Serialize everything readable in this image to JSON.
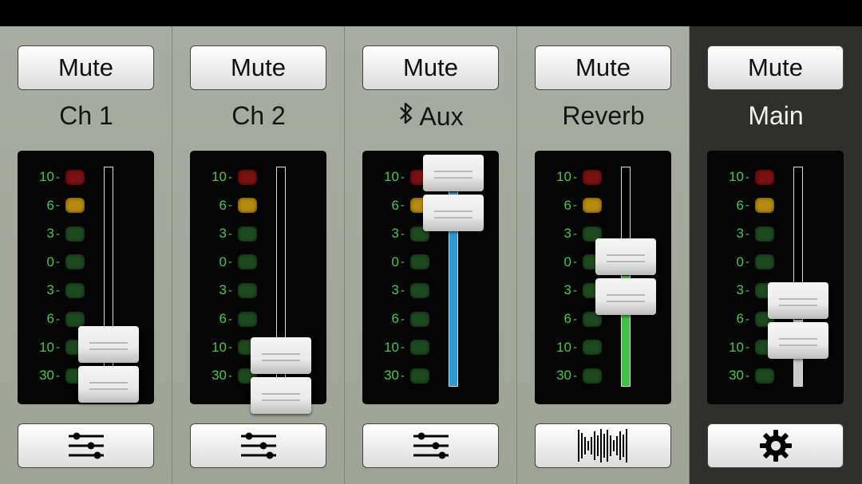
{
  "channels": [
    {
      "mute_label": "Mute",
      "name": "Ch 1",
      "bluetooth": false,
      "fader_level": 0.1,
      "fill_color": null,
      "settings_icon": "eq-sliders-icon"
    },
    {
      "mute_label": "Mute",
      "name": "Ch 2",
      "bluetooth": false,
      "fader_level": 0.05,
      "fill_color": null,
      "settings_icon": "eq-sliders-icon"
    },
    {
      "mute_label": "Mute",
      "name": "Aux",
      "bluetooth": true,
      "fader_level": 0.88,
      "fill_color": "#2c9ad4",
      "settings_icon": "eq-sliders-icon"
    },
    {
      "mute_label": "Mute",
      "name": "Reverb",
      "bluetooth": false,
      "fader_level": 0.5,
      "fill_color": "#3fc23f",
      "settings_icon": "reverb-waveform-icon"
    },
    {
      "mute_label": "Mute",
      "name": "Main",
      "bluetooth": false,
      "fader_level": 0.3,
      "fill_color": "#c9c9c9",
      "settings_icon": "gear-icon"
    }
  ],
  "meter_scale": [
    "10",
    "6",
    "3",
    "0",
    "3",
    "6",
    "10",
    "30"
  ],
  "colors": {
    "led_red": "#7a1010",
    "led_amber": "#b58a12",
    "led_green": "#1e4a1f",
    "scale_text": "#48c94b",
    "strip_bg": "#a8ada3",
    "main_strip_bg": "#2f2f2b"
  }
}
